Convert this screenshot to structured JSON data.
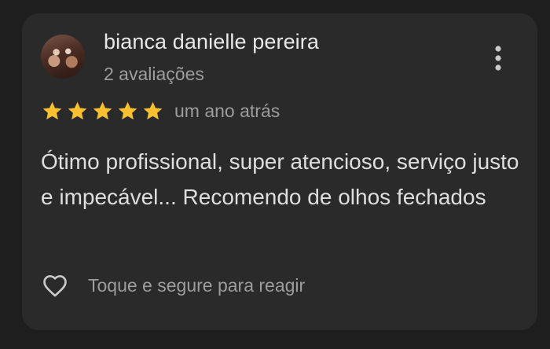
{
  "review": {
    "author_name": "bianca danielle pereira",
    "review_count": "2 avaliações",
    "rating": 5,
    "max_rating": 5,
    "time_ago": "um ano atrás",
    "text": "Ótimo profissional, super atencioso, serviço justo e impecável... Recomendo de olhos fechados",
    "react_label": "Toque e segure para reagir"
  },
  "icons": {
    "menu": "more-vert-icon",
    "star": "star-icon",
    "heart": "heart-outline-icon",
    "avatar": "profile-photo"
  },
  "colors": {
    "background": "#1e1e1f",
    "card": "#2a2a2b",
    "star": "#fbc02d",
    "primary_text": "#e8e8e8",
    "secondary_text": "#9d9d9d"
  }
}
